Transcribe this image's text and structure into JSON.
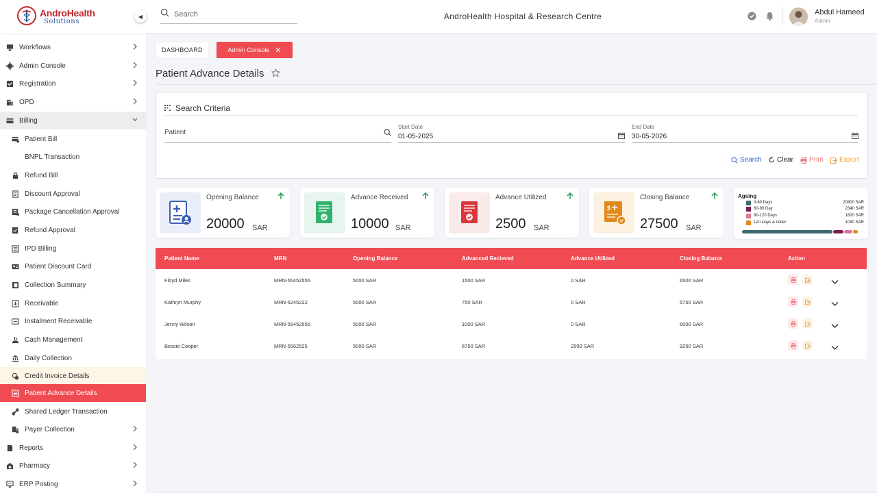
{
  "header": {
    "logo_title": "AndroHealth",
    "logo_subtitle": "Solutions",
    "search_placeholder": "Search",
    "hospital_name": "AndroHealth Hospital & Research Centre",
    "user_name": "Abdul Hameed",
    "user_role": "Admin"
  },
  "sidebar": {
    "items": [
      {
        "label": "Workflows",
        "icon": "monitor-icon",
        "chevron": true
      },
      {
        "label": "Admin Console",
        "icon": "gear-icon",
        "chevron": true
      },
      {
        "label": "Registration",
        "icon": "checkbox-icon",
        "chevron": true
      },
      {
        "label": "OPD",
        "icon": "building-icon",
        "chevron": true
      },
      {
        "label": "Billing",
        "icon": "card-icon",
        "chevron": true,
        "expanded": true
      }
    ],
    "billing_items": [
      {
        "label": "Patient Bill",
        "icon": "bill-icon"
      },
      {
        "label": "BNPL Transaction",
        "icon": ""
      },
      {
        "label": "Refund Bill",
        "icon": "refund-icon"
      },
      {
        "label": "Discount Approval",
        "icon": "doc-icon"
      },
      {
        "label": "Package Cancellation Approval",
        "icon": "package-icon"
      },
      {
        "label": "Refund Approval",
        "icon": "approval-icon"
      },
      {
        "label": "IPD Billing",
        "icon": "list-icon"
      },
      {
        "label": "Patient Discount Card",
        "icon": "id-card-icon"
      },
      {
        "label": "Collection Summary",
        "icon": "wallet-icon"
      },
      {
        "label": "Receivable",
        "icon": "receivable-icon"
      },
      {
        "label": "Instalment Receivable",
        "icon": "instalment-icon"
      },
      {
        "label": "Cash Management",
        "icon": "hand-cash-icon"
      },
      {
        "label": "Daily Collection",
        "icon": "bank-icon"
      },
      {
        "label": "Credit Invoice Details",
        "icon": "coins-icon"
      },
      {
        "label": "Patient Advance Details",
        "icon": "ledger-icon"
      },
      {
        "label": "Shared Ledger Transaction",
        "icon": "link-icon"
      },
      {
        "label": "Payer Collection",
        "icon": "payer-icon",
        "chevron": true
      }
    ],
    "bottom_items": [
      {
        "label": "Reports",
        "icon": "report-icon",
        "chevron": true
      },
      {
        "label": "Pharmacy",
        "icon": "pharmacy-icon",
        "chevron": true
      },
      {
        "label": "ERP Posting",
        "icon": "erp-icon",
        "chevron": true
      }
    ]
  },
  "breadcrumbs": {
    "dashboard": "DASHBOARD",
    "admin_console": "Admin Console"
  },
  "page_title": "Patient Advance Details",
  "search_criteria": {
    "title": "Search Criteria",
    "patient_placeholder": "Patient",
    "start_date_label": "Start Date",
    "start_date": "01-05-2025",
    "end_date_label": "End Date",
    "end_date": "30-05-2026",
    "search_label": "Search",
    "clear_label": "Clear",
    "print_label": "Print",
    "export_label": "Export"
  },
  "cards": [
    {
      "label": "Opening Balance",
      "value": "20000",
      "unit": "SAR"
    },
    {
      "label": "Advance Received",
      "value": "10000",
      "unit": "SAR"
    },
    {
      "label": "Advance Utilized",
      "value": "2500",
      "unit": "SAR"
    },
    {
      "label": "Closing Balance",
      "value": "27500",
      "unit": "SAR"
    }
  ],
  "ageing": {
    "title": "Ageing",
    "rows": [
      {
        "label": "0-60 Days",
        "value": "20800 SAR",
        "amount": 20800,
        "color": "#3e6b6b"
      },
      {
        "label": "60-90 Day",
        "value": "2340 SAR",
        "amount": 2340,
        "color": "#7b1e4f"
      },
      {
        "label": "90-120 Days",
        "value": "1820 SAR",
        "amount": 1820,
        "color": "#d87a92"
      },
      {
        "label": "120 Days & Older",
        "value": "1040 SAR",
        "amount": 1040,
        "color": "#e08a1c"
      }
    ]
  },
  "table": {
    "headers": [
      "Patient  Name",
      "MRN",
      "Opening Balance",
      "Advanced Recieved",
      "Advance Utilized",
      "Closing Balance",
      "Action"
    ],
    "rows": [
      [
        "Floyd Miles",
        "MRN-55452555",
        "5000 SAR",
        "1500 SAR",
        "0 SAR",
        "6500 SAR"
      ],
      [
        "Kathryn Murphy",
        "MRN-5245222",
        "5000 SAR",
        "750 SAR",
        "0 SAR",
        "5750 SAR"
      ],
      [
        "Jenny Wilson",
        "MRN-55452555",
        "5000  SAR",
        "1000  SAR",
        "0 SAR",
        "6000  SAR"
      ],
      [
        "Bessie Cooper",
        "MRN-5562525",
        "5000 SAR",
        "6750 SAR",
        "2500 SAR",
        "9250 SAR"
      ]
    ]
  },
  "colors": {
    "accent": "#f04b52",
    "search_blue": "#2d6cc0",
    "print": "#f07a80",
    "export": "#e9a23b"
  }
}
